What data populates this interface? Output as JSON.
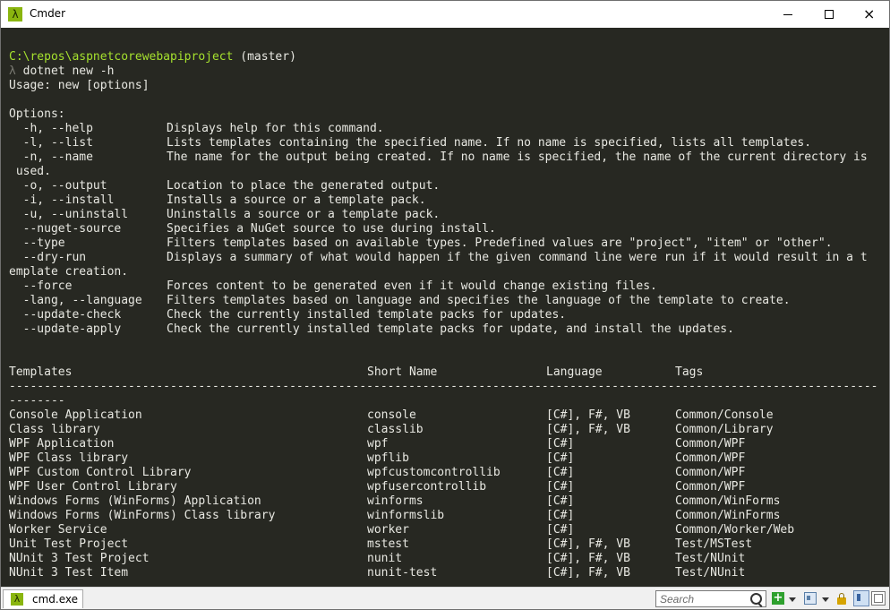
{
  "window": {
    "title": "Cmder",
    "app_icon": "λ",
    "controls": {
      "minimize": "minimize-icon",
      "maximize": "maximize-icon",
      "close": "×"
    }
  },
  "console": {
    "prompt_path": "C:\\repos\\aspnetcorewebapiproject",
    "prompt_branch": " (master)",
    "prompt_symbol": "λ",
    "command": " dotnet new -h",
    "usage": "Usage: new [options]",
    "options_header": "Options:",
    "options": [
      {
        "flag": "  -h, --help",
        "desc": "Displays help for this command."
      },
      {
        "flag": "  -l, --list",
        "desc": "Lists templates containing the specified name. If no name is specified, lists all templates."
      },
      {
        "flag": "  -n, --name",
        "desc": "The name for the output being created. If no name is specified, the name of the current directory is"
      },
      {
        "flag": "",
        "desc": "",
        "wrap": " used."
      },
      {
        "flag": "  -o, --output",
        "desc": "Location to place the generated output."
      },
      {
        "flag": "  -i, --install",
        "desc": "Installs a source or a template pack."
      },
      {
        "flag": "  -u, --uninstall",
        "desc": "Uninstalls a source or a template pack."
      },
      {
        "flag": "  --nuget-source",
        "desc": "Specifies a NuGet source to use during install."
      },
      {
        "flag": "  --type",
        "desc": "Filters templates based on available types. Predefined values are \"project\", \"item\" or \"other\"."
      },
      {
        "flag": "  --dry-run",
        "desc": "Displays a summary of what would happen if the given command line were run if it would result in a t"
      },
      {
        "flag": "",
        "desc": "",
        "wrap": "emplate creation."
      },
      {
        "flag": "  --force",
        "desc": "Forces content to be generated even if it would change existing files."
      },
      {
        "flag": "  -lang, --language",
        "desc": "Filters templates based on language and specifies the language of the template to create."
      },
      {
        "flag": "  --update-check",
        "desc": "Check the currently installed template packs for updates."
      },
      {
        "flag": "  --update-apply",
        "desc": "Check the currently installed template packs for update, and install the updates."
      }
    ],
    "table_headers": [
      "Templates",
      "Short Name",
      "Language",
      "Tags"
    ],
    "separator": "----------------------------------------------------------------------------------------------------------------------------",
    "separator_wrap": "--------",
    "templates": [
      {
        "name": "Console Application",
        "short": "console",
        "lang": "[C#], F#, VB",
        "tags": "Common/Console"
      },
      {
        "name": "Class library",
        "short": "classlib",
        "lang": "[C#], F#, VB",
        "tags": "Common/Library"
      },
      {
        "name": "WPF Application",
        "short": "wpf",
        "lang": "[C#]",
        "tags": "Common/WPF"
      },
      {
        "name": "WPF Class library",
        "short": "wpflib",
        "lang": "[C#]",
        "tags": "Common/WPF"
      },
      {
        "name": "WPF Custom Control Library",
        "short": "wpfcustomcontrollib",
        "lang": "[C#]",
        "tags": "Common/WPF"
      },
      {
        "name": "WPF User Control Library",
        "short": "wpfusercontrollib",
        "lang": "[C#]",
        "tags": "Common/WPF"
      },
      {
        "name": "Windows Forms (WinForms) Application",
        "short": "winforms",
        "lang": "[C#]",
        "tags": "Common/WinForms"
      },
      {
        "name": "Windows Forms (WinForms) Class library",
        "short": "winformslib",
        "lang": "[C#]",
        "tags": "Common/WinForms"
      },
      {
        "name": "Worker Service",
        "short": "worker",
        "lang": "[C#]",
        "tags": "Common/Worker/Web"
      },
      {
        "name": "Unit Test Project",
        "short": "mstest",
        "lang": "[C#], F#, VB",
        "tags": "Test/MSTest"
      },
      {
        "name": "NUnit 3 Test Project",
        "short": "nunit",
        "lang": "[C#], F#, VB",
        "tags": "Test/NUnit"
      },
      {
        "name": "NUnit 3 Test Item",
        "short": "nunit-test",
        "lang": "[C#], F#, VB",
        "tags": "Test/NUnit"
      }
    ]
  },
  "statusbar": {
    "tab_label": "cmd.exe",
    "tab_icon": "λ",
    "search_placeholder": "Search",
    "add_label": "+"
  },
  "colors": {
    "console_bg": "#272822",
    "console_fg": "#e8e8e2",
    "path_green": "#a6e22e",
    "prompt_lambda": "#7a7a72",
    "cmder_icon": "#8ab50f"
  }
}
